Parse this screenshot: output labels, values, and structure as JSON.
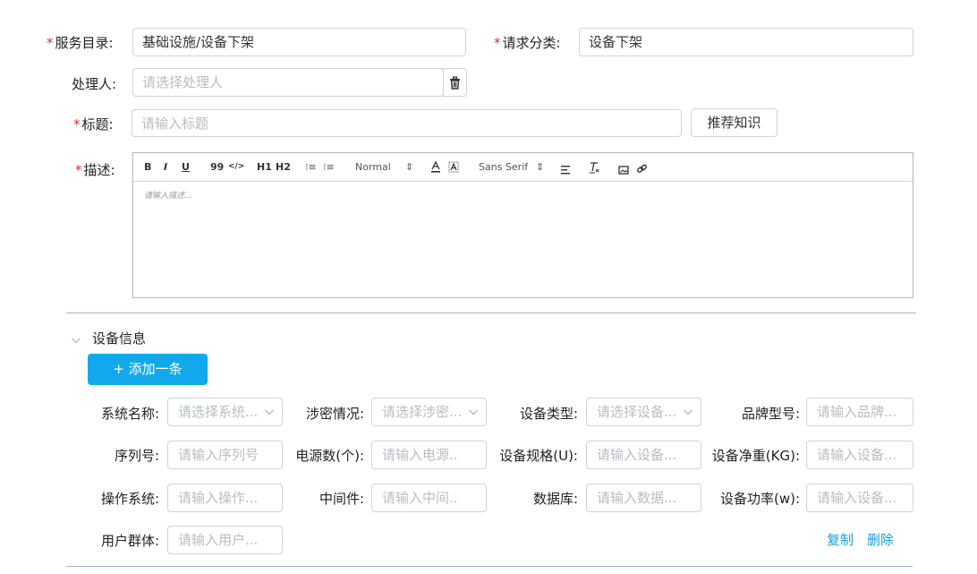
{
  "form": {
    "service_catalog": {
      "label": "服务目录:",
      "value": "基础设施/设备下架"
    },
    "request_category": {
      "label": "请求分类:",
      "value": "设备下架"
    },
    "handler": {
      "label": "处理人:",
      "placeholder": "请选择处理人"
    },
    "title": {
      "label": "标题:",
      "placeholder": "请输入标题"
    },
    "recommend_button": "推荐知识",
    "description": {
      "label": "描述:",
      "placeholder": "请输入描述...",
      "toolbar": {
        "bold": "B",
        "italic": "I",
        "underline": "U",
        "quote": "99",
        "code": "</>",
        "h1": "H1",
        "h2": "H2",
        "ordered": "⁝≡",
        "bullet": "⁝≡",
        "size": "Normal",
        "font": "Sans Serif",
        "size_arrow": "⇕",
        "font_arrow": "⇕"
      }
    }
  },
  "device_section": {
    "title": "设备信息",
    "add_button": "+ 添加一条",
    "fields": {
      "system_name": {
        "label": "系统名称:",
        "placeholder": "请选择系统..."
      },
      "classification": {
        "label": "涉密情况:",
        "placeholder": "请选择涉密..."
      },
      "device_type": {
        "label": "设备类型:",
        "placeholder": "请选择设备..."
      },
      "brand_model": {
        "label": "品牌型号:",
        "placeholder": "请输入品牌..."
      },
      "serial": {
        "label": "序列号:",
        "placeholder": "请输入序列号"
      },
      "power_count": {
        "label": "电源数(个):",
        "placeholder": "请输入电源.."
      },
      "spec": {
        "label": "设备规格(U):",
        "placeholder": "请输入设备..."
      },
      "net_weight": {
        "label": "设备净重(KG):",
        "placeholder": "请输入设备..."
      },
      "os": {
        "label": "操作系统:",
        "placeholder": "请输入操作..."
      },
      "middleware": {
        "label": "中间件:",
        "placeholder": "请输入中间.."
      },
      "database": {
        "label": "数据库:",
        "placeholder": "请输入数据..."
      },
      "power": {
        "label": "设备功率(w):",
        "placeholder": "请输入设备..."
      },
      "user_group": {
        "label": "用户群体:",
        "placeholder": "请输入用户..."
      }
    },
    "copy_link": "复制",
    "delete_link": "删除"
  }
}
